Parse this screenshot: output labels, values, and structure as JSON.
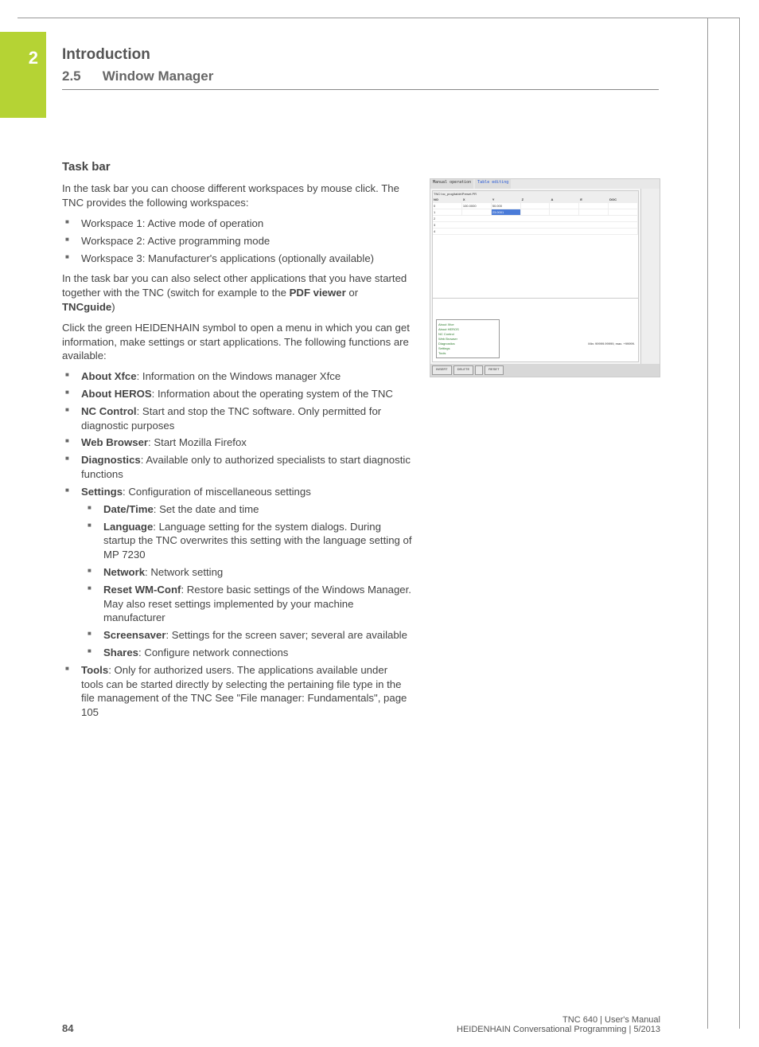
{
  "chapter_number": "2",
  "chapter_title": "Introduction",
  "section_number": "2.5",
  "section_title": "Window Manager",
  "heading": "Task bar",
  "p1": "In the task bar you can choose different workspaces by mouse click. The TNC provides the following workspaces:",
  "workspaces": [
    "Workspace 1: Active mode of operation",
    "Workspace 2: Active programming mode",
    "Workspace 3: Manufacturer's applications (optionally available)"
  ],
  "p2a": "In the task bar you can also select other applications that you have started together with the TNC (switch for example to the ",
  "p2b": "PDF viewer",
  "p2c": " or ",
  "p2d": "TNCguide",
  "p2e": ")",
  "p3": "Click the green HEIDENHAIN symbol to open a menu in which you can get information, make settings or start applications. The following functions are available:",
  "menu": [
    {
      "b": "About Xfce",
      "t": ": Information on the Windows manager Xfce"
    },
    {
      "b": "About HEROS",
      "t": ": Information about the operating system of the TNC"
    },
    {
      "b": "NC Control",
      "t": ": Start and stop the TNC software. Only permitted for diagnostic purposes"
    },
    {
      "b": "Web Browser",
      "t": ": Start Mozilla Firefox"
    },
    {
      "b": "Diagnostics",
      "t": ": Available only to authorized specialists to start diagnostic functions"
    },
    {
      "b": "Settings",
      "t": ": Configuration of miscellaneous settings",
      "sub": [
        {
          "b": "Date/Time",
          "t": ": Set the date and time"
        },
        {
          "b": "Language",
          "t": ": Language setting for the system dialogs. During startup the TNC overwrites this setting with the language setting of MP 7230"
        },
        {
          "b": "Network",
          "t": ": Network setting"
        },
        {
          "b": "Reset WM-Conf",
          "t": ": Restore basic settings of the Windows Manager. May also reset settings implemented by your machine manufacturer"
        },
        {
          "b": "Screensaver",
          "t": ": Settings for the screen saver; several are available"
        },
        {
          "b": "Shares",
          "t": ": Configure network connections"
        }
      ]
    },
    {
      "b": "Tools",
      "t": ": Only for authorized users. The applications available under tools can be started directly by selecting the pertaining file type in the file management of the TNC See \"File manager: Fundamentals\", page 105"
    }
  ],
  "screenshot": {
    "mode1": "Manual operation",
    "mode2": "Table editing",
    "path": "TNC:\\nc_prog\\table\\Preset.PR",
    "cols": [
      "NO",
      "X",
      "Y",
      "Z",
      "A",
      "E",
      "DOC"
    ],
    "row0": [
      "0",
      "100.0000",
      "50.000",
      "",
      "",
      "",
      ""
    ],
    "row1": [
      "1",
      "",
      "23.0001",
      "",
      "",
      "",
      ""
    ],
    "menu_items": [
      "About Xfce",
      "About HEROS",
      "NC Control",
      "Web Browser",
      "Diagnostics",
      "Settings",
      "Tools"
    ],
    "status": "Min: 99999.99999, max. +99999.",
    "buttons": [
      "INSERT",
      "DELETE",
      "",
      "RESET"
    ]
  },
  "footer": {
    "page": "84",
    "line1": "TNC 640 | User's Manual",
    "line2": "HEIDENHAIN Conversational Programming | 5/2013"
  }
}
